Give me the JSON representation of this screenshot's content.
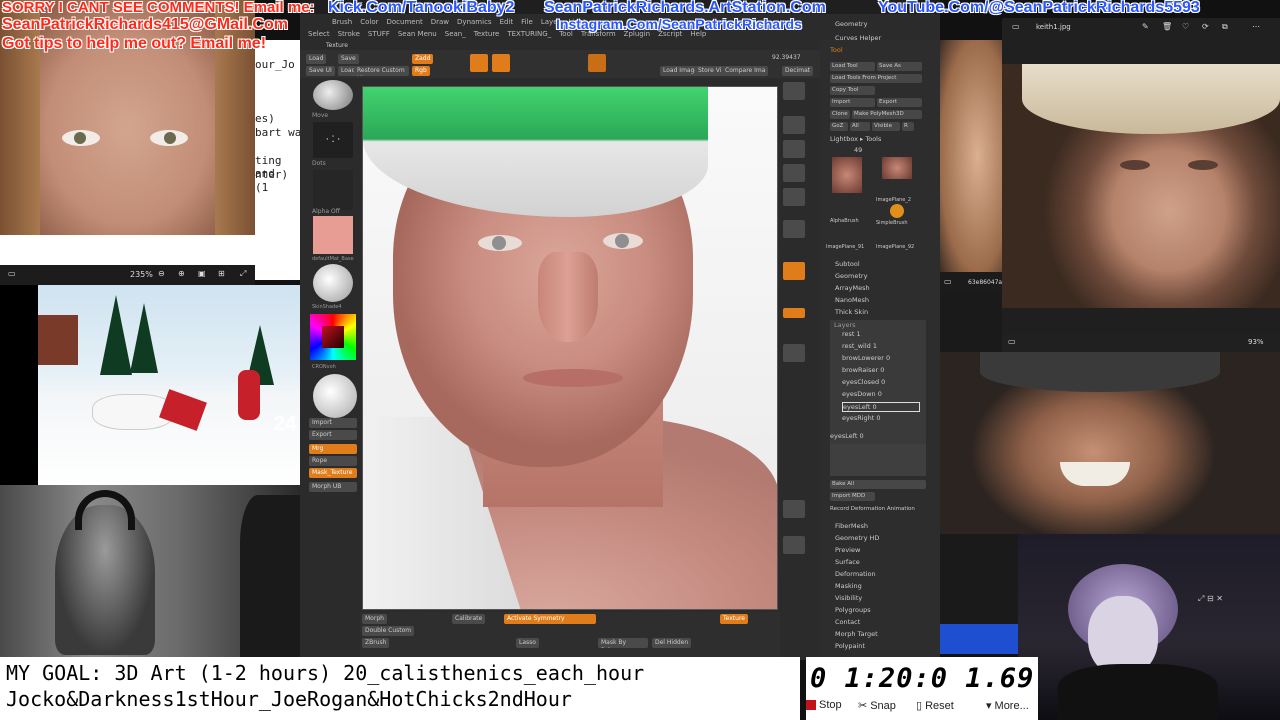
{
  "overlay": {
    "line1_red": "SORRY I CANT SEE COMMENTS! Email me:",
    "line1_blue": "Kick.Com/TanookiBaby2",
    "line1_blue2": "SeanPatrickRichards.ArtStation.Com",
    "line1_blue3": "YouTube.Com/@SeanPatrickRichards5593",
    "line2_red": "SeanPatrickRichards415@GMail.Com",
    "line2_blue": "Instagram.Com/SeanPatrickRichards",
    "line3_red": "Got tips to help me out? Email me!"
  },
  "top_left_viewer": {
    "zoom": "235%",
    "peek_text": [
      "our_Jo",
      "es)",
      "bart wa",
      "ting and",
      "nter) (1"
    ]
  },
  "snowman_video": {
    "overlay_number": "24"
  },
  "zbrush": {
    "menus": [
      "Brush",
      "Color",
      "Document",
      "Draw",
      "Dynamics",
      "Edit",
      "File",
      "Layer",
      "Light",
      "Macro",
      "Marker",
      "Material",
      "Movie"
    ],
    "menus2": [
      "Select",
      "Stroke",
      "STUFF",
      "Sean Menu",
      "Sean_",
      "Texture",
      "TEXTURING_",
      "Tool",
      "Transform",
      "Zplugin",
      "Zscript",
      "Help"
    ],
    "tab_texture": "Texture",
    "shelf_left": [
      "Load",
      "Save",
      "Save UI",
      "Load",
      "Restore Custom UI",
      "Zadd",
      "Rgb"
    ],
    "coords": "92.39437",
    "shelf_right": [
      "Load Image",
      "Store Vi",
      "Compare Ima",
      "Decimat"
    ],
    "left_tray": [
      "Move",
      "Dots",
      "Alpha Off",
      "defaultMat_Base",
      "SkinShade4",
      "CRONvoh",
      "Import",
      "Export",
      "Mrg",
      "Rope",
      "Mask_Texture",
      "Morph UB"
    ],
    "right_panel_head": [
      "Geometry",
      "Curves Helper",
      "Tool"
    ],
    "tool_buttons": [
      "Load Tool",
      "Save As",
      "Load Tools From Project",
      "Copy Tool",
      "Import",
      "Export",
      "Clone",
      "Make PolyMesh3D",
      "GoZ",
      "All",
      "Visible",
      "R"
    ],
    "lightbox": "Lightbox ▸ Tools",
    "brush_count": "49",
    "thumbs": [
      "KEITH",
      "KEITH",
      "AlphaBrush",
      "ImagePlane_2",
      "ImagePlane_91",
      "SimpleBrush",
      "ImagePlane_92"
    ],
    "subtools": [
      "Subtool",
      "Geometry",
      "ArrayMesh",
      "NanoMesh",
      "Thick Skin",
      "Layers"
    ],
    "layers": [
      "rest 1",
      "rest_wild 1",
      "browLowerer 0",
      "browRaiser 0",
      "eyesClosed 0",
      "eyesDown 0",
      "eyesLeft 0",
      "eyesRight 0"
    ],
    "eye_left": "eyesLeft 0",
    "bake": [
      "Bake All",
      "Import MDD"
    ],
    "record": "Record Deformation Animation",
    "lower_menu": [
      "FiberMesh",
      "Geometry HD",
      "Preview",
      "Surface",
      "Deformation",
      "Masking",
      "Visibility",
      "Polygroups",
      "Contact",
      "Morph Target",
      "Polypaint"
    ],
    "bottom_shelf": [
      "Morph",
      "Double Custom",
      "ZBrush",
      "Calibrate",
      "Activate Symmetry",
      "Lasso",
      "Mask By Polygroups",
      "Del Hidden",
      "Texture"
    ]
  },
  "photo_viewer": {
    "filename": "keith1.jpg",
    "zoom": "93%",
    "side_filename": "63e86047a4"
  },
  "goal": {
    "line1": "MY GOAL: 3D Art (1-2 hours) 20_calisthenics_each_hour",
    "line2": "Jocko&Darkness1stHour_JoeRogan&HotChicks2ndHour"
  },
  "timer": {
    "display": "0 1:20:0 1.69",
    "stop": "Stop",
    "snap": "Snap",
    "reset": "Reset",
    "more": "More..."
  },
  "colors": {
    "zbrush_orange": "#e07d1a",
    "overlay_red": "#ff2a1a",
    "overlay_blue": "#2a56ff"
  }
}
